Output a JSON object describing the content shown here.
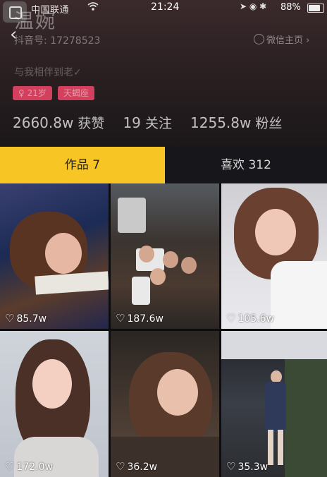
{
  "status_bar": {
    "carrier": "中国联通",
    "time": "21:24",
    "battery": "88%",
    "battery_level": 0.88
  },
  "profile": {
    "nickname": "温婉",
    "douyin_id": "抖音号: 17278523",
    "wechat_link": "微信主页 ›",
    "signature": "与我相伴到老✓",
    "tags": [
      "♀ 21岁",
      "天蝎座"
    ],
    "stats": [
      {
        "value": "2660.8w",
        "label": "获赞"
      },
      {
        "value": "19",
        "label": "关注"
      },
      {
        "value": "1255.8w",
        "label": "粉丝"
      }
    ]
  },
  "tabs": [
    {
      "label": "作品 7",
      "active": true
    },
    {
      "label": "喜欢 312",
      "active": false
    }
  ],
  "videos": [
    {
      "likes": "85.7w"
    },
    {
      "likes": "187.6w"
    },
    {
      "likes": "105.6w"
    },
    {
      "likes": "172.0w"
    },
    {
      "likes": "36.2w"
    },
    {
      "likes": "35.3w"
    }
  ],
  "colors": {
    "accent": "#f7c625",
    "tag": "#d2405e"
  }
}
